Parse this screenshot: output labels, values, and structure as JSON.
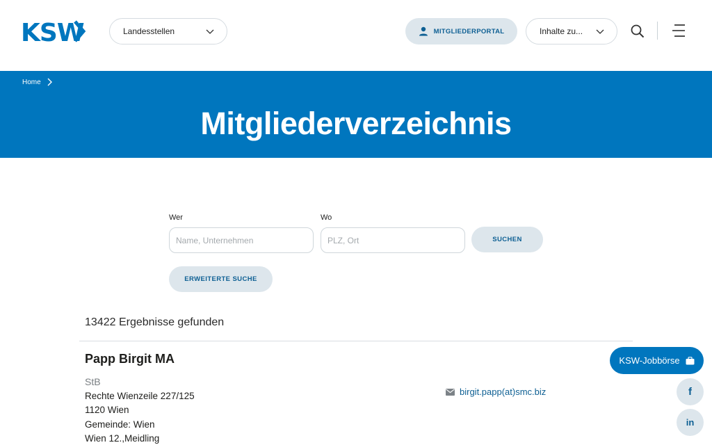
{
  "header": {
    "logo_text": "KSW",
    "landesstellen_label": "Landesstellen",
    "portal_label": "MITGLIEDERPORTAL",
    "inhalte_label": "Inhalte zu..."
  },
  "hero": {
    "breadcrumb_home": "Home",
    "title": "Mitgliederverzeichnis"
  },
  "search": {
    "wer_label": "Wer",
    "wer_placeholder": "Name, Unternehmen",
    "wo_label": "Wo",
    "wo_placeholder": "PLZ, Ort",
    "submit_label": "SUCHEN",
    "advanced_label": "ERWEITERTE SUCHE"
  },
  "results": {
    "count_text": "13422 Ergebnisse gefunden",
    "entries": [
      {
        "name": "Papp Birgit MA",
        "title": "StB",
        "address_lines": [
          "Rechte Wienzeile 227/125",
          "1120 Wien",
          "Gemeinde: Wien",
          "Wien 12.,Meidling"
        ],
        "email": "birgit.papp(at)smc.biz"
      }
    ]
  },
  "floating": {
    "jobs_label": "KSW-Jobbörse",
    "facebook_glyph": "f",
    "linkedin_glyph": "in"
  },
  "colors": {
    "brand_blue": "#0076be",
    "soft_button": "#dde6ec",
    "link_blue": "#0d5f93"
  }
}
